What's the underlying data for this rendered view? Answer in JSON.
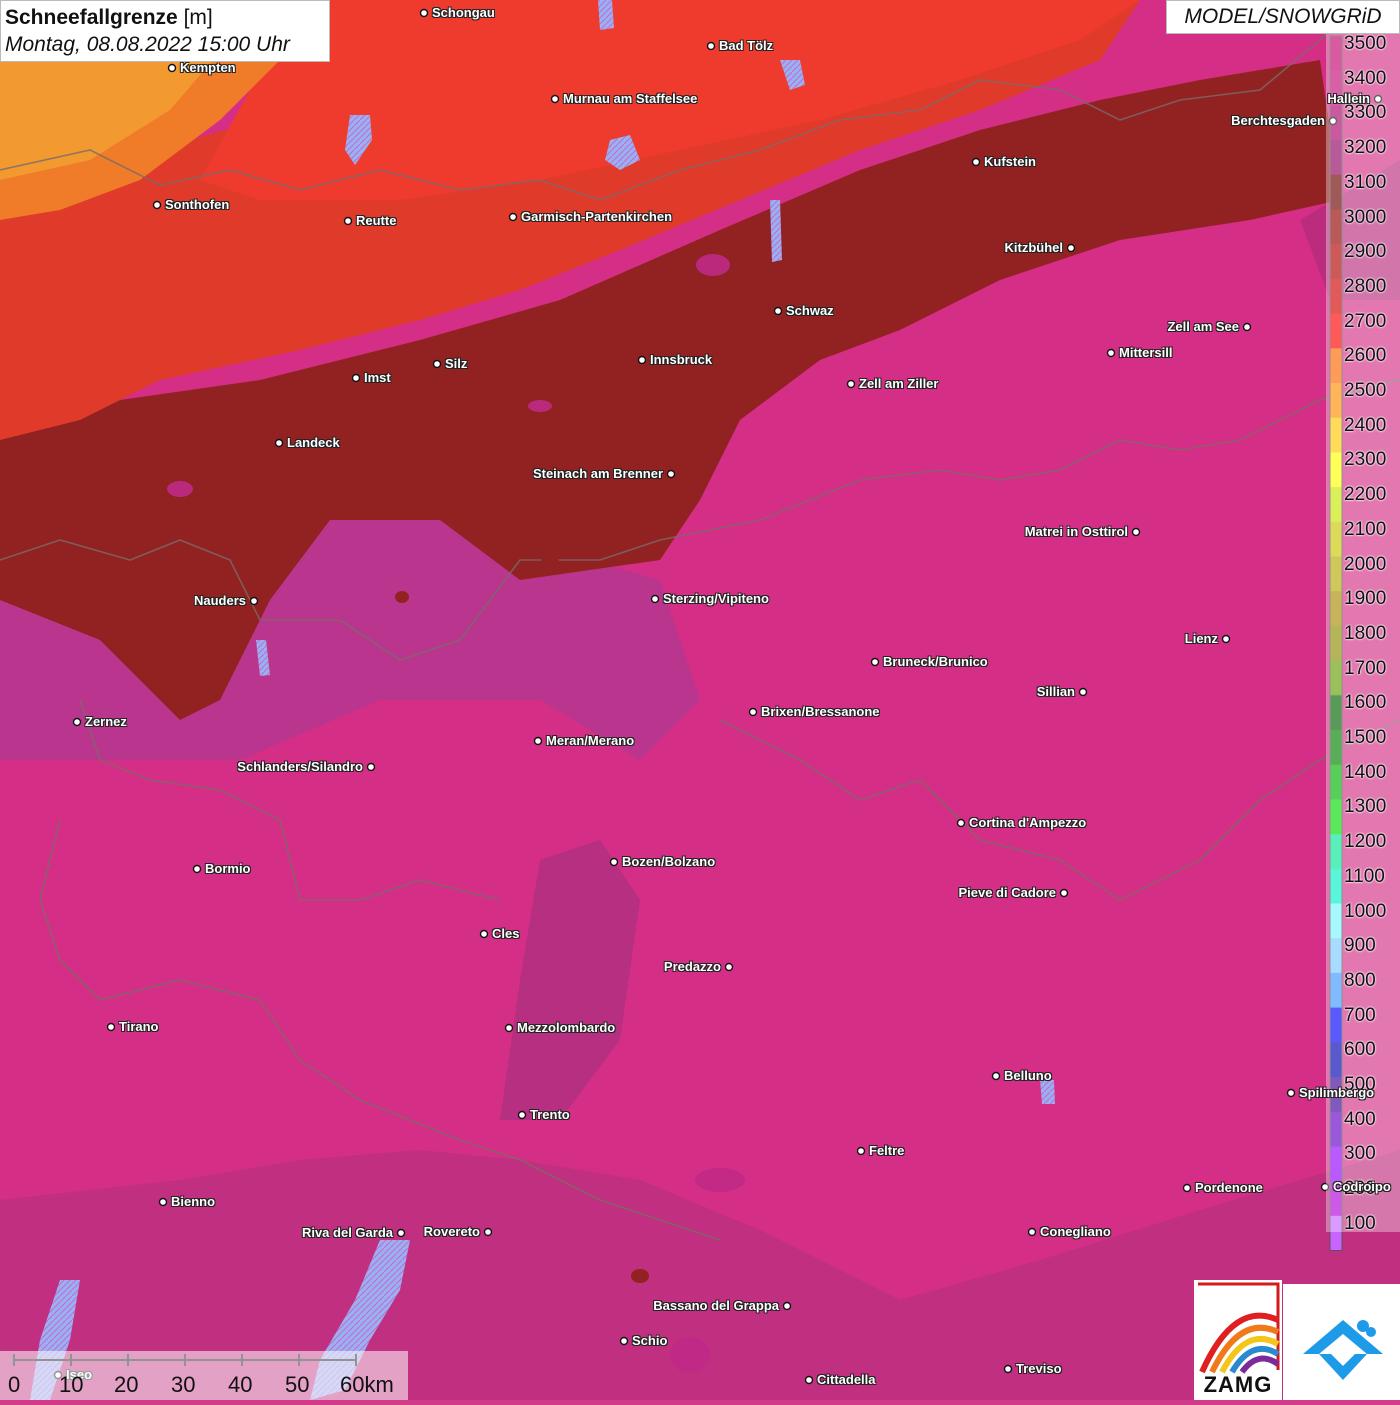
{
  "header": {
    "title_bold": "Schneefallgrenze",
    "title_unit": "[m]",
    "subtitle": "Montag, 08.08.2022 15:00 Uhr",
    "model": "MODEL/SNOWGRiD"
  },
  "legend": [
    {
      "value": "3500",
      "color": "#c8006e"
    },
    {
      "value": "3400",
      "color": "#c80a78"
    },
    {
      "value": "3300",
      "color": "#b0006e"
    },
    {
      "value": "3200",
      "color": "#960064"
    },
    {
      "value": "3100",
      "color": "#6e0000"
    },
    {
      "value": "3000",
      "color": "#960000"
    },
    {
      "value": "2900",
      "color": "#b40000"
    },
    {
      "value": "2800",
      "color": "#d20000"
    },
    {
      "value": "2700",
      "color": "#ff0000"
    },
    {
      "value": "2600",
      "color": "#ff6400"
    },
    {
      "value": "2500",
      "color": "#ff8c00"
    },
    {
      "value": "2400",
      "color": "#ffc800"
    },
    {
      "value": "2300",
      "color": "#ffff00"
    },
    {
      "value": "2200",
      "color": "#c8e600"
    },
    {
      "value": "2100",
      "color": "#c8c800"
    },
    {
      "value": "2000",
      "color": "#b4aa00"
    },
    {
      "value": "1900",
      "color": "#aa8c00"
    },
    {
      "value": "1800",
      "color": "#8c8c00"
    },
    {
      "value": "1700",
      "color": "#64a000"
    },
    {
      "value": "1600",
      "color": "#006400"
    },
    {
      "value": "1500",
      "color": "#008200"
    },
    {
      "value": "1400",
      "color": "#00b400"
    },
    {
      "value": "1300",
      "color": "#00dc00"
    },
    {
      "value": "1200",
      "color": "#00e696"
    },
    {
      "value": "1100",
      "color": "#00f0c8"
    },
    {
      "value": "1000",
      "color": "#78f5ff"
    },
    {
      "value": "900",
      "color": "#78c8ff"
    },
    {
      "value": "800",
      "color": "#3c96ff"
    },
    {
      "value": "700",
      "color": "#0000ff"
    },
    {
      "value": "600",
      "color": "#0000b4"
    },
    {
      "value": "500",
      "color": "#3c0096"
    },
    {
      "value": "400",
      "color": "#6400c8"
    },
    {
      "value": "300",
      "color": "#9600ff"
    },
    {
      "value": "200",
      "color": "#b400dc"
    },
    {
      "value": "100",
      "color": "#c864ff"
    }
  ],
  "cities": [
    {
      "name": "Schongau"
    },
    {
      "name": "Bad Tölz"
    },
    {
      "name": "Kempten"
    },
    {
      "name": "Murnau am Staffelsee"
    },
    {
      "name": "Hallein"
    },
    {
      "name": "Berchtesgaden"
    },
    {
      "name": "Kufstein"
    },
    {
      "name": "Sonthofen"
    },
    {
      "name": "Reutte"
    },
    {
      "name": "Garmisch-Partenkirchen"
    },
    {
      "name": "Kitzbühel"
    },
    {
      "name": "Schwaz"
    },
    {
      "name": "Zell am See"
    },
    {
      "name": "Mittersill"
    },
    {
      "name": "Imst"
    },
    {
      "name": "Silz"
    },
    {
      "name": "Innsbruck"
    },
    {
      "name": "Zell am Ziller"
    },
    {
      "name": "Landeck"
    },
    {
      "name": "Steinach am Brenner"
    },
    {
      "name": "Matrei in Osttirol"
    },
    {
      "name": "Nauders"
    },
    {
      "name": "Sterzing/Vipiteno"
    },
    {
      "name": "Lienz"
    },
    {
      "name": "Bruneck/Brunico"
    },
    {
      "name": "Sillian"
    },
    {
      "name": "Zernez"
    },
    {
      "name": "Brixen/Bressanone"
    },
    {
      "name": "Meran/Merano"
    },
    {
      "name": "Schlanders/Silandro"
    },
    {
      "name": "Cortina d'Ampezzo"
    },
    {
      "name": "Bozen/Bolzano"
    },
    {
      "name": "Bormio"
    },
    {
      "name": "Pieve di Cadore"
    },
    {
      "name": "Cles"
    },
    {
      "name": "Predazzo"
    },
    {
      "name": "Tirano"
    },
    {
      "name": "Mezzolombardo"
    },
    {
      "name": "Belluno"
    },
    {
      "name": "Spilimbergo"
    },
    {
      "name": "Trento"
    },
    {
      "name": "Feltre"
    },
    {
      "name": "Pordenone"
    },
    {
      "name": "Codroipo"
    },
    {
      "name": "Bienno"
    },
    {
      "name": "Riva del Garda"
    },
    {
      "name": "Rovereto"
    },
    {
      "name": "Conegliano"
    },
    {
      "name": "Bassano del Grappa"
    },
    {
      "name": "Schio"
    },
    {
      "name": "Treviso"
    },
    {
      "name": "Iseo"
    },
    {
      "name": "Cittadella"
    }
  ],
  "scalebar": {
    "ticks": [
      "0",
      "10",
      "20",
      "30",
      "40",
      "50",
      "60km"
    ]
  },
  "logos": {
    "zamg": "ZAMG"
  }
}
